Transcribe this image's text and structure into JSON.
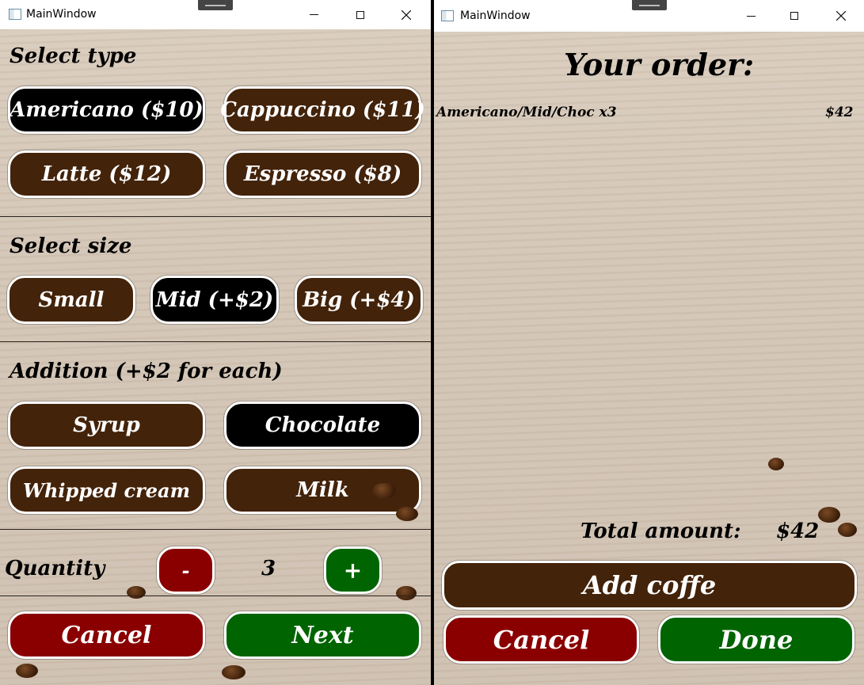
{
  "left_window": {
    "title": "MainWindow",
    "select_type": {
      "heading": "Select type",
      "options": [
        "Americano ($10)",
        "Cappuccino ($11)",
        "Latte ($12)",
        "Espresso ($8)"
      ],
      "selected": "Americano ($10)"
    },
    "select_size": {
      "heading": "Select size",
      "options": [
        "Small",
        "Mid (+$2)",
        "Big (+$4)"
      ],
      "selected": "Mid (+$2)"
    },
    "addition": {
      "heading": "Addition (+$2 for each)",
      "options": [
        "Syrup",
        "Chocolate",
        "Whipped cream",
        "Milk"
      ],
      "selected": "Chocolate"
    },
    "quantity": {
      "label": "Quantity",
      "minus_label": "-",
      "value": "3",
      "plus_label": "+"
    },
    "cancel_label": "Cancel",
    "next_label": "Next"
  },
  "right_window": {
    "title": "MainWindow",
    "order_heading": "Your order:",
    "order_items": [
      {
        "description": "Americano/Mid/Choc x3",
        "price": "$42"
      }
    ],
    "total_label": "Total amount:",
    "total_value": "$42",
    "add_label": "Add coffe",
    "cancel_label": "Cancel",
    "done_label": "Done"
  },
  "colors": {
    "brown": "#43230a",
    "selected": "#000000",
    "cancel": "#8a0000",
    "confirm": "#006400"
  }
}
